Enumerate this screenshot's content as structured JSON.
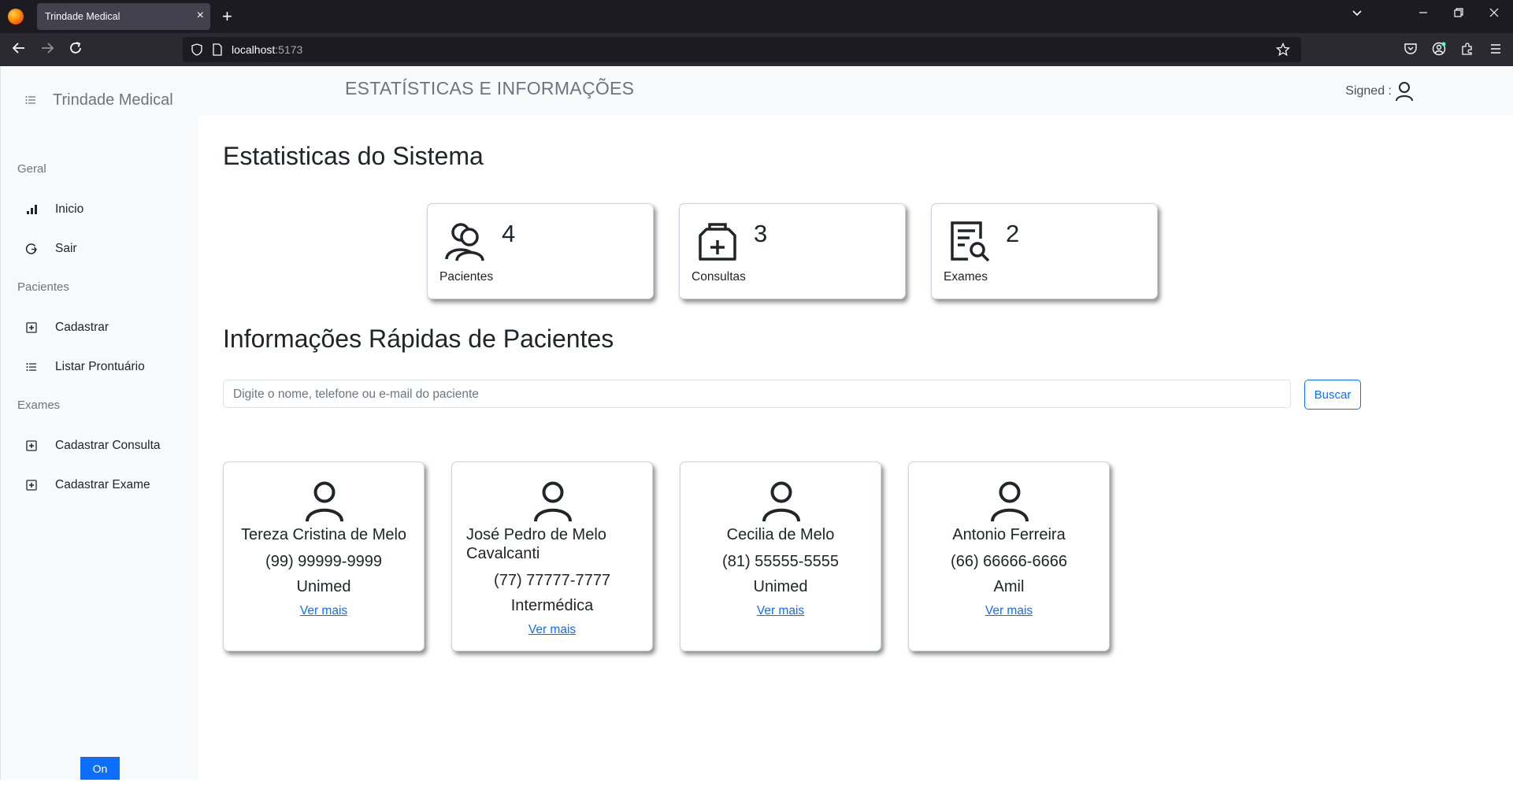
{
  "browser": {
    "tab_title": "Trindade Medical",
    "tab_close": "×",
    "new_tab": "+",
    "url_host": "localhost",
    "url_port": ":5173"
  },
  "sidebar": {
    "brand": "Trindade Medical",
    "sections": [
      {
        "title": "Geral",
        "items": [
          {
            "label": "Inicio",
            "icon": "bar-chart-icon"
          },
          {
            "label": "Sair",
            "icon": "logout-icon"
          }
        ]
      },
      {
        "title": "Pacientes",
        "items": [
          {
            "label": "Cadastrar",
            "icon": "plus-square-icon"
          },
          {
            "label": "Listar Prontuário",
            "icon": "list-icon"
          }
        ]
      },
      {
        "title": "Exames",
        "items": [
          {
            "label": "Cadastrar Consulta",
            "icon": "plus-square-icon"
          },
          {
            "label": "Cadastrar Exame",
            "icon": "plus-square-icon"
          }
        ]
      }
    ],
    "toggle_label": "On"
  },
  "header": {
    "title": "ESTATÍSTICAS E INFORMAÇÕES",
    "signed_label": "Signed :"
  },
  "stats": {
    "heading": "Estatisticas do Sistema",
    "cards": [
      {
        "value": "4",
        "label": "Pacientes",
        "icon": "patients-icon"
      },
      {
        "value": "3",
        "label": "Consultas",
        "icon": "medical-bag-icon"
      },
      {
        "value": "2",
        "label": "Exames",
        "icon": "exam-search-icon"
      }
    ]
  },
  "quick_info": {
    "heading": "Informações Rápidas de Pacientes",
    "search_placeholder": "Digite o nome, telefone ou e-mail do paciente",
    "search_button": "Buscar"
  },
  "patients": [
    {
      "name": "Tereza Cristina de Melo",
      "phone": "(99) 99999-9999",
      "plan": "Unimed",
      "link": "Ver mais"
    },
    {
      "name": "José Pedro de Melo Cavalcanti",
      "phone": "(77) 77777-7777",
      "plan": "Intermédica",
      "link": "Ver mais"
    },
    {
      "name": "Cecilia de Melo",
      "phone": "(81) 55555-5555",
      "plan": "Unimed",
      "link": "Ver mais"
    },
    {
      "name": "Antonio Ferreira",
      "phone": "(66) 66666-6666",
      "plan": "Amil",
      "link": "Ver mais"
    }
  ],
  "colors": {
    "primary": "#0d6efd",
    "sidebar_bg": "#f8f9fa",
    "browser_bg": "#1c1b22"
  }
}
